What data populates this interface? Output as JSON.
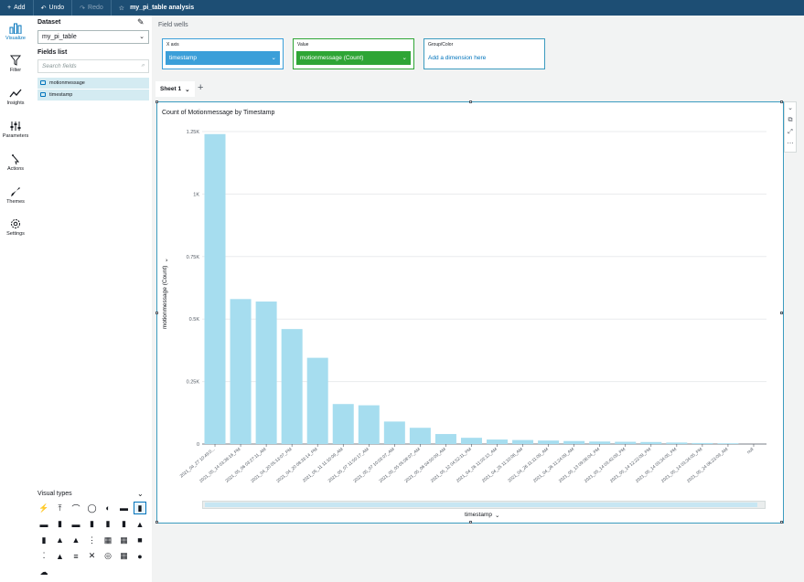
{
  "toolbar": {
    "add_label": "Add",
    "undo_label": "Undo",
    "redo_label": "Redo",
    "analysis_title": "my_pi_table analysis"
  },
  "rail": [
    {
      "label": "Visualize",
      "icon": "visualize-icon"
    },
    {
      "label": "Filter",
      "icon": "filter-icon"
    },
    {
      "label": "Insights",
      "icon": "insights-icon"
    },
    {
      "label": "Parameters",
      "icon": "parameters-icon"
    },
    {
      "label": "Actions",
      "icon": "actions-icon"
    },
    {
      "label": "Themes",
      "icon": "themes-icon"
    },
    {
      "label": "Settings",
      "icon": "settings-icon"
    }
  ],
  "dataset": {
    "label": "Dataset",
    "selected": "my_pi_table"
  },
  "fields": {
    "label": "Fields list",
    "search_placeholder": "Search fields",
    "items": [
      "motionmessage",
      "timestamp"
    ]
  },
  "visual_types": {
    "label": "Visual types"
  },
  "field_wells": {
    "title": "Field wells",
    "x_axis": {
      "label": "X axis",
      "value": "timestamp",
      "color": "#3b9fd9"
    },
    "value": {
      "label": "Value",
      "value": "motionmessage (Count)",
      "color": "#2ea535"
    },
    "group": {
      "label": "Group/Color",
      "placeholder": "Add a dimension here"
    }
  },
  "sheet": {
    "tab_label": "Sheet 1"
  },
  "colors": {
    "bar": "#a6ddef",
    "accent": "#0073bb",
    "topbar": "#1d4e74"
  },
  "chart_data": {
    "type": "bar",
    "title": "Count of Motionmessage by Timestamp",
    "xlabel": "timestamp",
    "ylabel": "motionmessage (Count)",
    "ylim": [
      0,
      1250
    ],
    "yticks": [
      0,
      250,
      500,
      750,
      1000,
      1250
    ],
    "ytick_labels": [
      "0",
      "0.25K",
      "0.5K",
      "0.75K",
      "1K",
      "1.25K"
    ],
    "grid": true,
    "categories": [
      "2021_04_27 10:49:0...",
      "2021_05_14 03:38:16_PM",
      "2021_05_06 03:27:11_AM",
      "2021_04_20 05:13:07_PM",
      "2021_04_20 08:33:14_PM",
      "2021_05_11 11:10:09_AM",
      "2021_05_07 11:50:17_AM",
      "2021_05_07 10:03:07_AM",
      "2021_05_05 05:08:07_AM",
      "2021_05_06 04:50:09_AM",
      "2021_05_12 04:52:11_PM",
      "2021_04_26 11:03:13_AM",
      "2021_04_25 11:10:06_AM",
      "2021_04_26 11:11:09_AM",
      "2021_04_26 11:24:09_AM",
      "2021_05_13 09:06:04_PM",
      "2021_05_14 03:43:09_PM",
      "2021_05_14 12:22:09_PM",
      "2021_05_14 03:34:05_PM",
      "2021_05_14 03:34:05_PM",
      "2021_05_24 06:23:09_AM",
      "null"
    ],
    "values": [
      1240,
      580,
      570,
      460,
      345,
      160,
      155,
      90,
      65,
      40,
      25,
      18,
      16,
      14,
      12,
      10,
      9,
      8,
      6,
      4,
      3,
      0
    ]
  }
}
